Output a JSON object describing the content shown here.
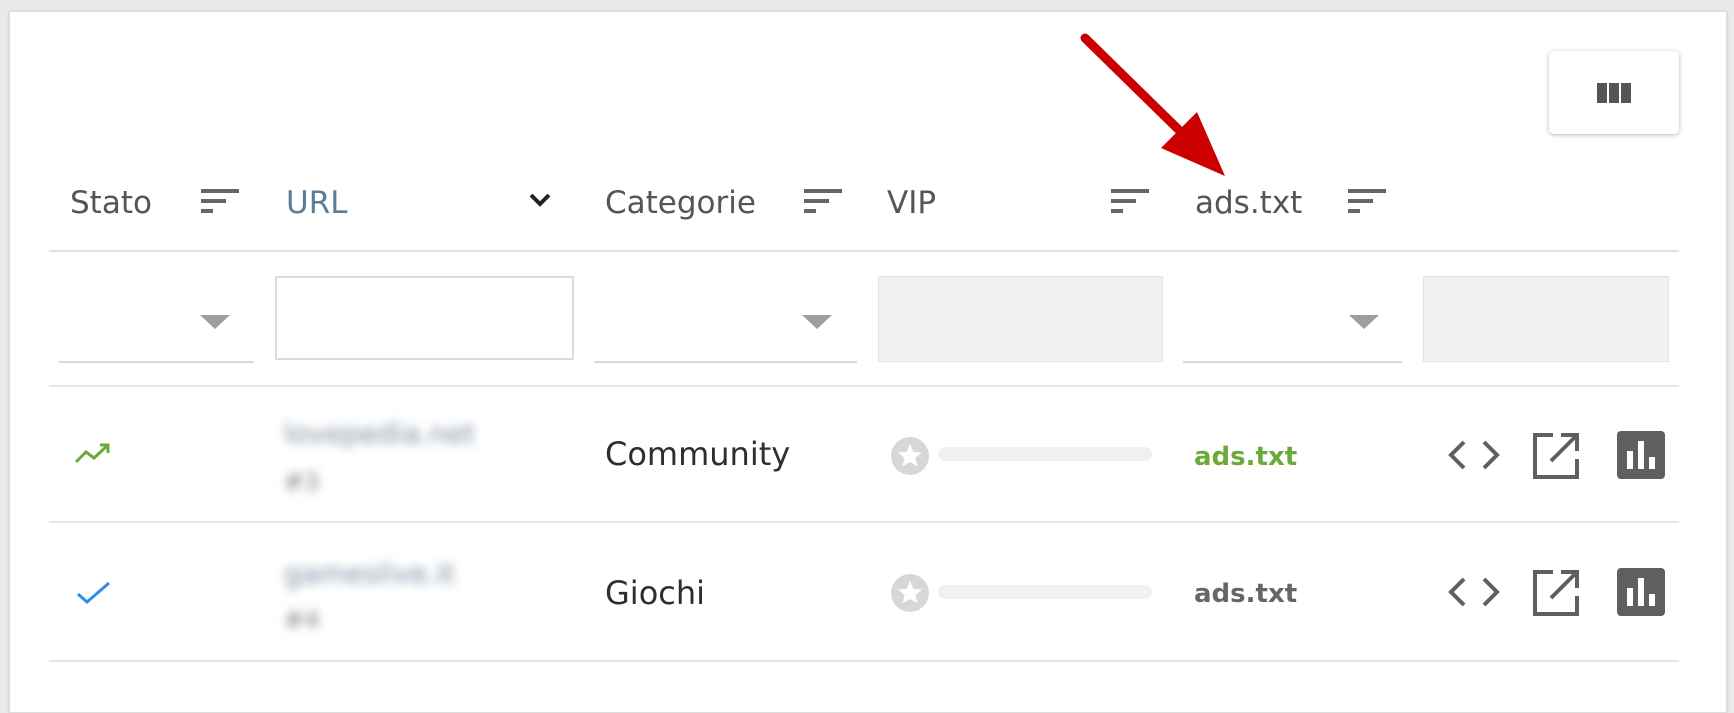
{
  "colors": {
    "accent_green": "#6aaa38",
    "accent_blue": "#2f8fe3",
    "header_url": "#5b7e96",
    "annotation_arrow": "#cc0000",
    "icon_grey": "#5f5f5f"
  },
  "toolbar": {
    "columns_icon": "view-column-icon"
  },
  "header": {
    "columns": [
      {
        "label": "Stato",
        "icon": "sort-icon"
      },
      {
        "label": "URL",
        "icon": "chevron-down-icon"
      },
      {
        "label": "Categorie",
        "icon": "sort-icon"
      },
      {
        "label": "VIP",
        "icon": "sort-icon"
      },
      {
        "label": "ads.txt",
        "icon": "sort-icon"
      }
    ]
  },
  "filters": {
    "stato": {
      "value": ""
    },
    "url": {
      "value": ""
    },
    "categorie": {
      "value": ""
    },
    "adstxt": {
      "value": ""
    }
  },
  "rows": [
    {
      "status_icon": "trending-up-icon",
      "status_color": "#6aaa38",
      "url": "lovepedia.net",
      "id": "#3",
      "category": "Community",
      "vip_icon": "star-icon",
      "adstxt": "ads.txt",
      "adstxt_color": "#6aaa38",
      "actions": [
        "code-icon",
        "open-external-icon",
        "bar-chart-icon"
      ]
    },
    {
      "status_icon": "check-icon",
      "status_color": "#2f8fe3",
      "url": "gameslive.it",
      "id": "#4",
      "category": "Giochi",
      "vip_icon": "star-icon",
      "adstxt": "ads.txt",
      "adstxt_color": "#666666",
      "actions": [
        "code-icon",
        "open-external-icon",
        "bar-chart-icon"
      ]
    }
  ]
}
